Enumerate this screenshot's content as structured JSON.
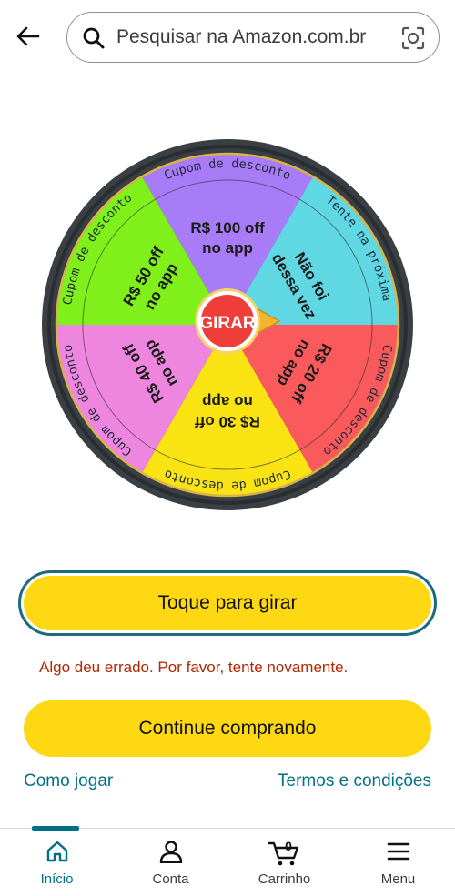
{
  "header": {
    "search_placeholder": "Pesquisar na Amazon.com.br"
  },
  "wheel": {
    "center_label": "GIRAR",
    "segments": [
      {
        "line1": "R$ 100 off",
        "line2": "no app",
        "rim": "Cupom de desconto",
        "color": "#a97cf7"
      },
      {
        "line1": "Não foi",
        "line2": "dessa vez",
        "rim": "Tente na próxima",
        "color": "#5fd8e4"
      },
      {
        "line1": "R$ 20 off",
        "line2": "no app",
        "rim": "Cupom de desconto",
        "color": "#fa5a5c"
      },
      {
        "line1": "R$ 30 off",
        "line2": "no app",
        "rim": "Cupom de desconto",
        "color": "#f9e312"
      },
      {
        "line1": "R$ 40 off",
        "line2": "no app",
        "rim": "Cupom de desconto",
        "color": "#ee86df"
      },
      {
        "line1": "R$ 50 off",
        "line2": "no app",
        "rim": "Cupom de desconto",
        "color": "#7ff01a"
      }
    ]
  },
  "spin_button": {
    "label": "Toque para girar"
  },
  "error_message": "Algo deu errado. Por favor, tente novamente.",
  "continue_button": {
    "label": "Continue comprando"
  },
  "links": {
    "how_to_play": "Como jogar",
    "terms": "Termos e condições"
  },
  "bottom_nav": {
    "items": [
      {
        "label": "Início",
        "icon": "home-icon",
        "active": true
      },
      {
        "label": "Conta",
        "icon": "account-icon",
        "active": false
      },
      {
        "label": "Carrinho",
        "icon": "cart-icon",
        "active": false,
        "badge": "0"
      },
      {
        "label": "Menu",
        "icon": "menu-icon",
        "active": false
      }
    ]
  },
  "colors": {
    "accent": "#007185",
    "button_yellow": "#ffd814",
    "error": "#b12704",
    "wheel_rim": "#3a3f44"
  }
}
